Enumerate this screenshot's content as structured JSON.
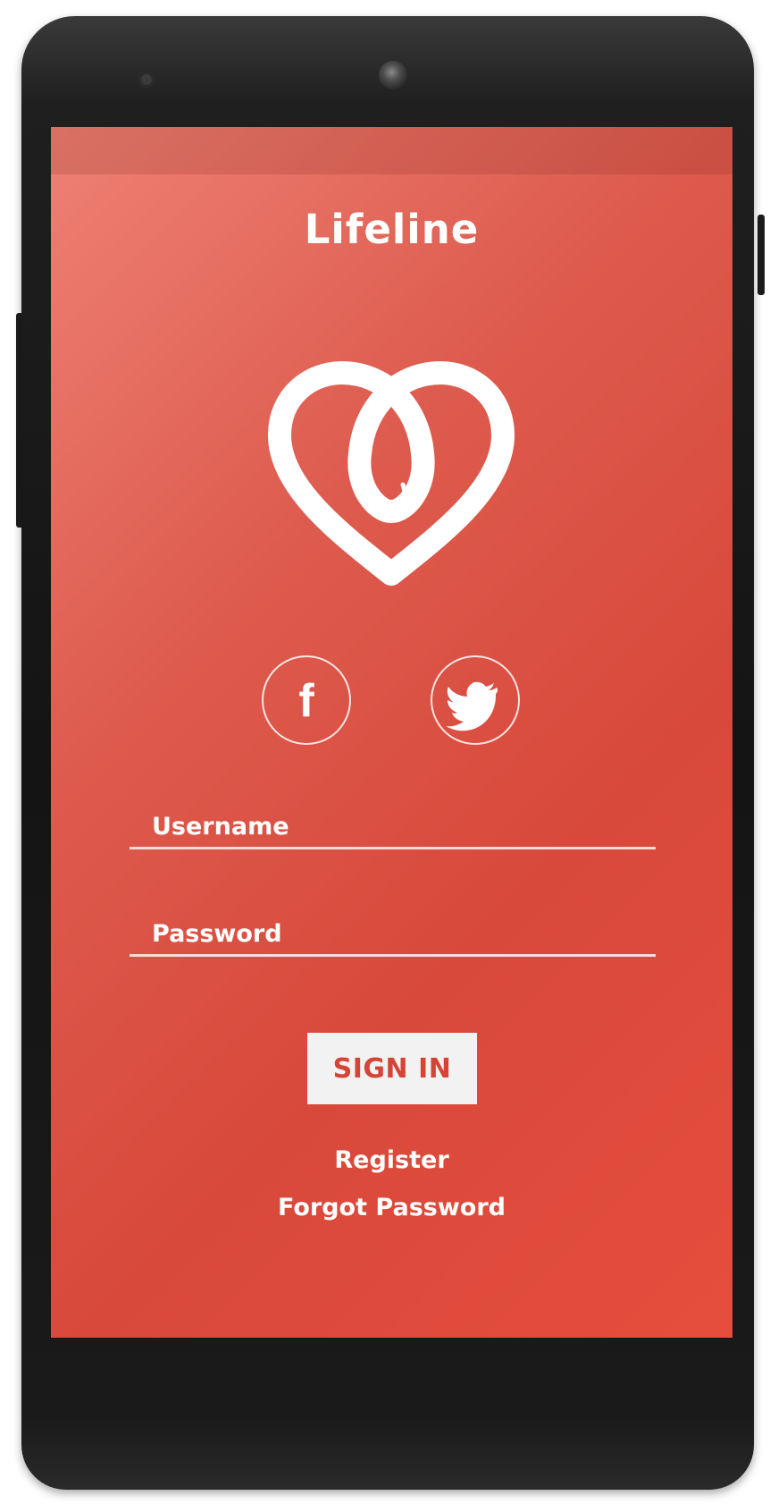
{
  "app": {
    "title": "Lifeline"
  },
  "colors": {
    "accent": "#dd4a3c",
    "button_text": "#d64436",
    "button_bg": "#f2f2f2"
  },
  "logo": {
    "icon": "heart-drop-icon"
  },
  "social": [
    {
      "name": "facebook",
      "icon": "facebook-icon",
      "glyph": "f"
    },
    {
      "name": "twitter",
      "icon": "twitter-icon"
    }
  ],
  "form": {
    "username": {
      "placeholder": "Username",
      "value": ""
    },
    "password": {
      "placeholder": "Password",
      "value": ""
    },
    "signin_label": "SIGN IN"
  },
  "links": {
    "register": "Register",
    "forgot": "Forgot Password"
  }
}
